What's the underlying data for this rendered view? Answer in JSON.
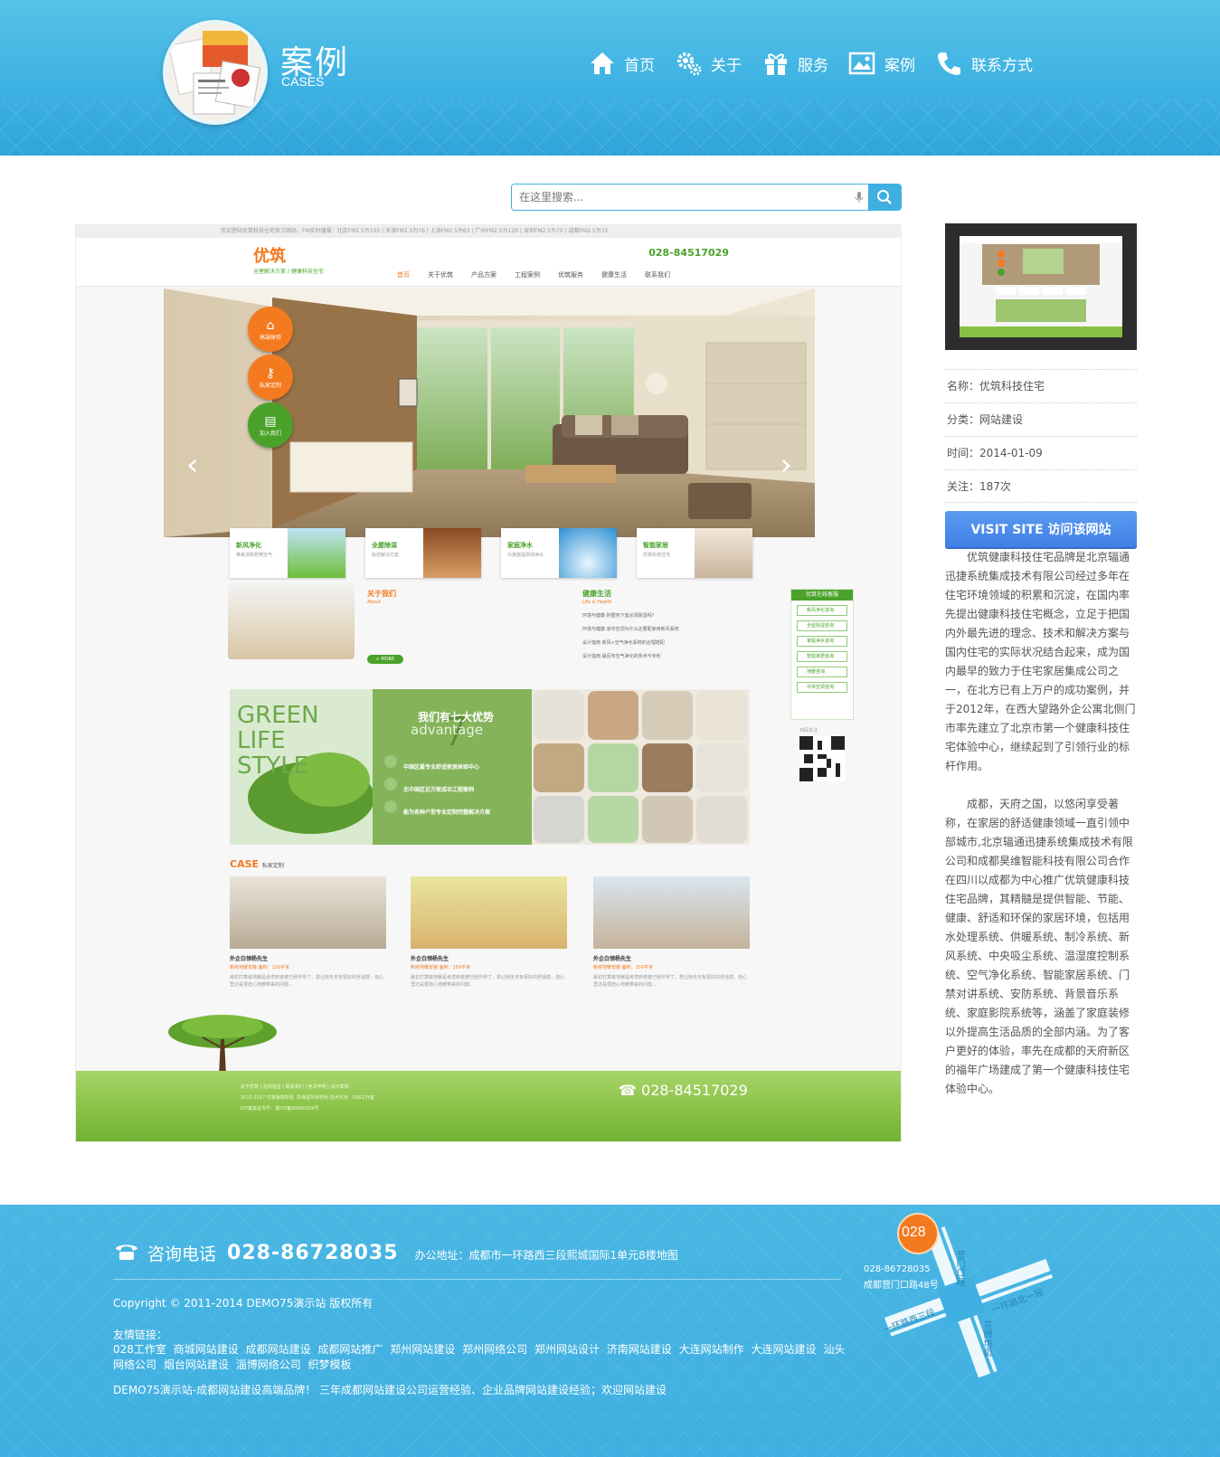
{
  "header": {
    "title": "案例",
    "subtitle": "CASES",
    "nav": [
      {
        "label": "首页",
        "icon": "home-icon"
      },
      {
        "label": "关于",
        "icon": "gears-icon"
      },
      {
        "label": "服务",
        "icon": "gift-icon"
      },
      {
        "label": "案例",
        "icon": "picture-icon"
      },
      {
        "label": "联系方式",
        "icon": "phone-icon"
      }
    ]
  },
  "search": {
    "placeholder": "在这里搜索..."
  },
  "preview": {
    "topbar": "欢迎登陆优筑科技住宅官方网站，FM实时播报：北京FM2.5为105 | 天津FM2.5为76 | 上海FM2.5为63 | 广州FM2.5为129 | 深圳FM2.5为70 | 成都FM2.5为72",
    "logo": "优筑",
    "logo_sub": "全屋解决方案 / 健康科技住宅",
    "phone": "028-84517029",
    "nav": [
      "首页",
      "关于优筑",
      "产品方案",
      "工程案例",
      "优筑服务",
      "健康生活",
      "联系我们"
    ],
    "bubbles": [
      "高端体验",
      "私家定制",
      "加入我们"
    ],
    "tiles": [
      {
        "title": "新风净化",
        "sub": "带来清新舒爽空气"
      },
      {
        "title": "全屋除湿",
        "sub": "给您解决方案"
      },
      {
        "title": "家庭净水",
        "sub": "为家庭提供纯净水"
      },
      {
        "title": "智能家居",
        "sub": "优筑科技住宅"
      }
    ],
    "about_title": "关于我们",
    "about_en": "About",
    "life_title": "健康生活",
    "life_en": "Life & Health",
    "life_items": [
      "环境与健康 别墅地下室必须除湿吗?",
      "环境与健康 家中空调为什么还要配家用新风系统",
      "设计指南 新风+空气净化系统的合理搭配",
      "设计指南 最尼布空气净化的技术与专利"
    ],
    "service_title": "优筑在线客服",
    "service_items": [
      "新风净化咨询",
      "全屋除湿咨询",
      "家庭净水咨询",
      "智能家居咨询",
      "地暖咨询",
      "中央空调咨询"
    ],
    "qr_label": "扫码关注",
    "green_text": "GREEN LIFE STYLE",
    "advantage_title": "我们有七大优势",
    "advantage_en": "advantage",
    "advantage_items": [
      "中国区最专业舒适家居体验中心",
      "北中国区近万家成功工程案例",
      "能为各种户型专业定制完整解决方案"
    ],
    "case_title": "CASE",
    "case_sub": "私家定制",
    "cases": [
      {
        "title": "外企白领杨先生",
        "sub": "新房地暖安装 面积：150平米",
        "desc": "最初打算装地暖是考虑到老婆已经怀孕了，想让她冬天有更好的舒适感，但心里还是很担心地暖带来的问题..."
      },
      {
        "title": "外企白领杨先生",
        "sub": "新房地暖安装 面积：150平米",
        "desc": "最初打算装地暖是考虑到老婆已经怀孕了，想让她冬天有更好的舒适感，但心里还是很担心地暖带来的问题..."
      },
      {
        "title": "外企白领杨先生",
        "sub": "新房地暖安装 面积：150平米",
        "desc": "最初打算装地暖是考虑到老婆已经怀孕了，想让她冬天有更好的舒适感，但心里还是很担心地暖带来的问题..."
      }
    ],
    "foot_phone": "028-84517029",
    "foot_text": "关于优筑 | 在线留言 | 联系我们 | 免责声明 | 设计案例\n2013-2017 优筑版权所有, 并保留所有权利  技术支持：028工作室\nICP备案证书号：蜀ICP备00000334号"
  },
  "sidebar": {
    "meta": [
      {
        "label": "名称：优筑科技住宅"
      },
      {
        "label": "分类：网站建设"
      },
      {
        "label": "时间：2014-01-09"
      },
      {
        "label": "关注：187次"
      }
    ],
    "visit_label": "VISIT SITE 访问该网站",
    "desc": [
      "优筑健康科技住宅品牌是北京辐通迅捷系统集成技术有限公司经过多年在住宅环境领域的积累和沉淀，在国内率先提出健康科技住宅概念，立足于把国内外最先进的理念、技术和解决方案与国内住宅的实际状况结合起来，成为国内最早的致力于住宅家居集成公司之一，在北方已有上万户的成功案例，并于2012年，在西大望路外企公寓北侧门市率先建立了北京市第一个健康科技住宅体验中心，继续起到了引领行业的标杆作用。",
      "成都，天府之国，以悠闲享受著称，在家居的舒适健康领域一直引领中部城市,北京辐通迅捷系统集成技术有限公司和成都昊维智能科技有限公司合作在四川以成都为中心推广优筑健康科技住宅品牌，其精髓是提供智能、节能、健康、舒适和环保的家居环境，包括用水处理系统、供暖系统、制冷系统、新风系统、中央吸尘系统、温湿度控制系统、空气净化系统、智能家居系统、门禁对讲系统、安防系统、背景音乐系统、家庭影院系统等，涵盖了家庭装修以外提高生活品质的全部内涵。为了客户更好的体验，率先在成都的天府新区的福年广场建成了第一个健康科技住宅体验中心。"
    ]
  },
  "footer": {
    "phone_label": "咨询电话",
    "phone": "028-86728035",
    "address": "办公地址：成都市一环路西三段熙城国际1单元8楼地图",
    "copyright": "Copyright © 2011-2014 DEMO75演示站 版权所有",
    "links_title": "友情链接：",
    "links": [
      "028工作室",
      "商城网站建设",
      "成都网站建设",
      "成都网站推广",
      "郑州网站建设",
      "郑州网络公司",
      "郑州网站设计",
      "济南网站建设",
      "大连网站制作",
      "大连网站建设",
      "汕头网络公司",
      "烟台网站建设",
      "淄博网络公司",
      "织梦模板"
    ],
    "slogan": "DEMO75演示站-成都网站建设高端品牌！ 三年成都网站建设公司运营经验、企业品牌网站建设经验；欢迎网站建设",
    "map": {
      "badge": "028",
      "phone": "028-86728035",
      "addr": "成都营门口路48号",
      "road1": "营门口路",
      "road2": "一环路北一段",
      "road3": "一环路西三段",
      "road4": "花牌坊街"
    }
  }
}
